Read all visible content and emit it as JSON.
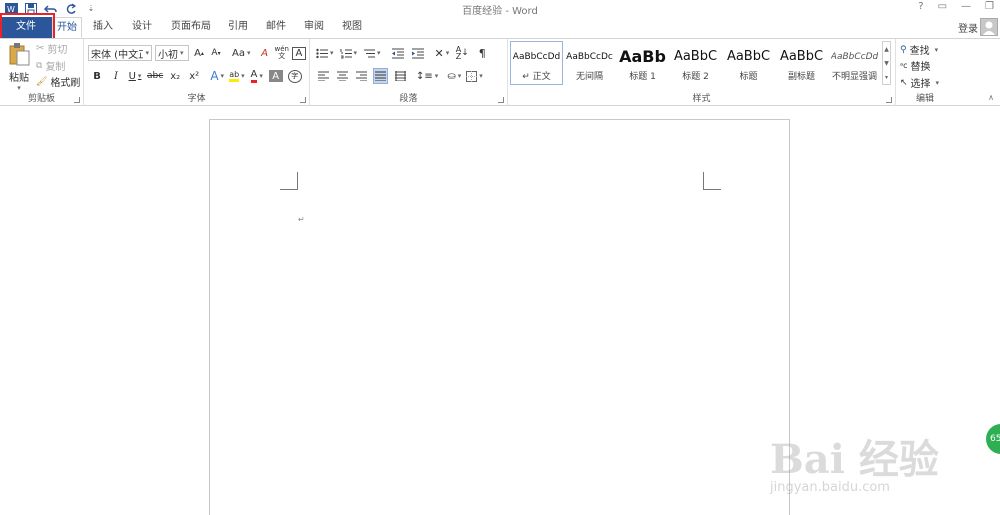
{
  "window": {
    "title": "百度经验 - Word",
    "controls": [
      "?",
      "▭",
      "—",
      "❐"
    ],
    "qat_icons": [
      "word-logo-icon",
      "save-icon",
      "undo-icon",
      "redo-icon",
      "customize-icon"
    ]
  },
  "tabs": [
    "文件",
    "开始",
    "插入",
    "设计",
    "页面布局",
    "引用",
    "邮件",
    "审阅",
    "视图"
  ],
  "account": {
    "login_label": "登录"
  },
  "clipboard": {
    "paste": "粘贴",
    "cut": "剪切",
    "copy": "复制",
    "format_painter": "格式刷",
    "label": "剪贴板"
  },
  "font": {
    "name": "宋体 (中文正̇",
    "size": "小初",
    "grow": "A",
    "shrink": "A",
    "case": "Aa",
    "clear": "A",
    "phonetic": "wén\n文",
    "border": "A",
    "bold": "B",
    "italic": "I",
    "underline": "U",
    "strike": "abc",
    "subscript": "x₂",
    "superscript": "x²",
    "effects": "A",
    "highlight": "ab",
    "color": "A",
    "shading": "A",
    "enclose": "字",
    "label": "字体"
  },
  "paragraph": {
    "label": "段落"
  },
  "styles": {
    "items": [
      {
        "sample": "AaBbCcDd",
        "name": "↵ 正文"
      },
      {
        "sample": "AaBbCcDc",
        "name": "无间隔"
      },
      {
        "sample": "AaBb",
        "name": "标题 1"
      },
      {
        "sample": "AaBbC",
        "name": "标题 2"
      },
      {
        "sample": "AaBbC",
        "name": "标题"
      },
      {
        "sample": "AaBbC",
        "name": "副标题"
      },
      {
        "sample": "AaBbCcDd",
        "name": "不明显强调"
      }
    ],
    "label": "样式"
  },
  "editing": {
    "find": "查找",
    "replace": "替换",
    "select": "选择",
    "label": "编辑"
  },
  "document": {
    "paragraph_mark": "↵"
  },
  "watermark": {
    "main": "Bai 经验",
    "sub": "jingyan.baidu.com",
    "badge": "65"
  },
  "colors": {
    "file_tab": "#2b579a",
    "highlight_box": "#e8242b",
    "font_red": "#e8242b",
    "highlight_yellow": "#ffeb00"
  }
}
